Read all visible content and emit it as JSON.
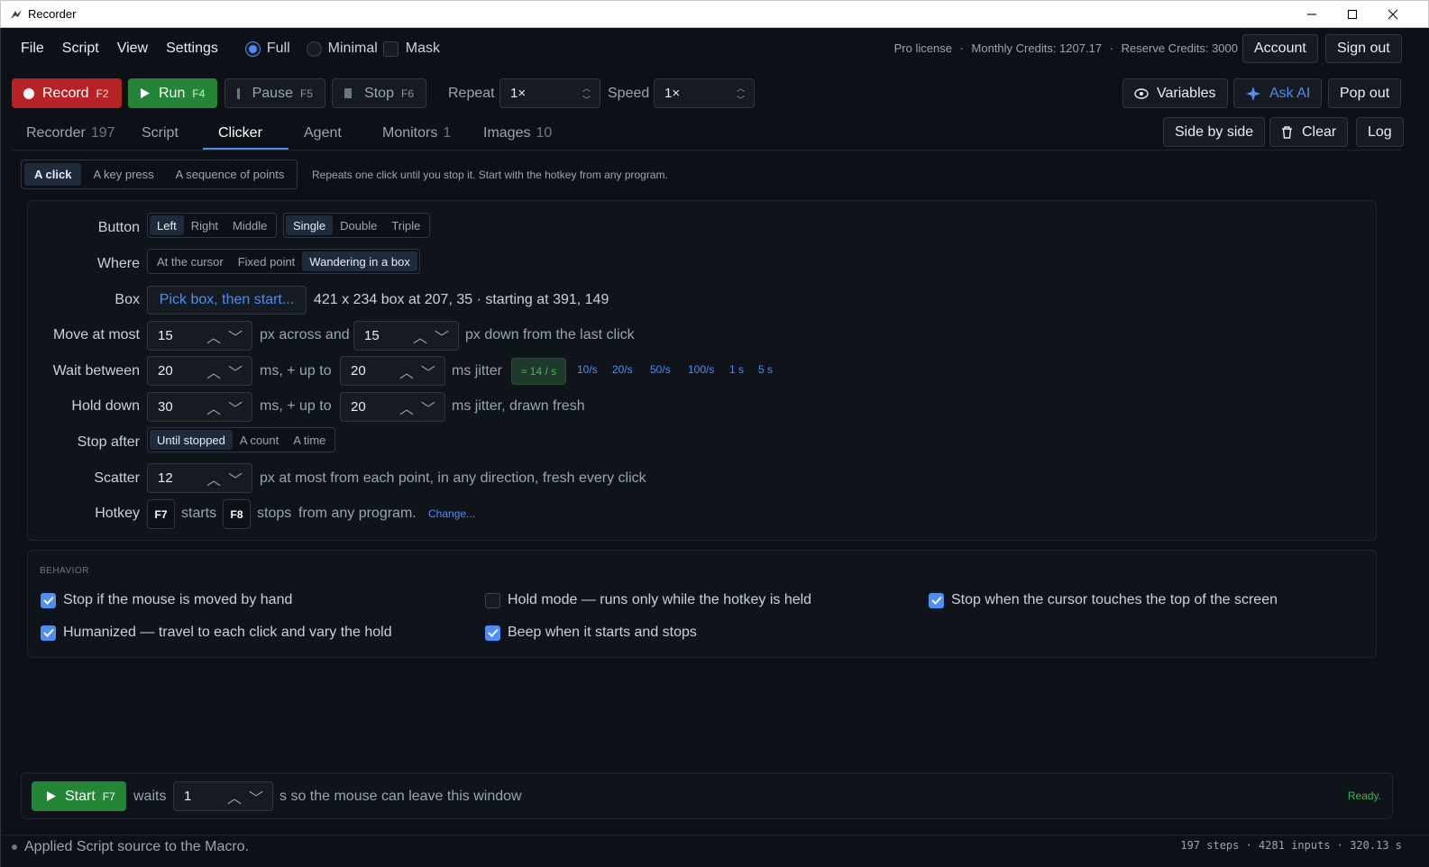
{
  "window": {
    "title": "Recorder"
  },
  "menu": {
    "items": [
      "File",
      "Script",
      "View",
      "Settings"
    ]
  },
  "view_mode": {
    "options": [
      "Full",
      "Minimal"
    ],
    "selected": "Full",
    "mask_label": "Mask",
    "mask_checked": false
  },
  "account": {
    "license": "Pro license",
    "monthly_credits": "Monthly Credits: 1207.17",
    "reserve_credits": "Reserve Credits: 3000",
    "account_label": "Account",
    "signout_label": "Sign out"
  },
  "toolbar": {
    "record": {
      "label": "Record",
      "key": "F2"
    },
    "run": {
      "label": "Run",
      "key": "F4"
    },
    "pause": {
      "label": "Pause",
      "key": "F5"
    },
    "stop": {
      "label": "Stop",
      "key": "F6"
    },
    "repeat_label": "Repeat",
    "repeat_value": "1×",
    "speed_label": "Speed",
    "speed_value": "1×",
    "variables_label": "Variables",
    "ask_ai_label": "Ask AI",
    "popout_label": "Pop out"
  },
  "tabs": [
    {
      "label": "Recorder",
      "count": "197"
    },
    {
      "label": "Script",
      "count": ""
    },
    {
      "label": "Clicker",
      "count": "",
      "active": true
    },
    {
      "label": "Agent",
      "count": ""
    },
    {
      "label": "Monitors",
      "count": "1"
    },
    {
      "label": "Images",
      "count": "10"
    }
  ],
  "tab_actions": {
    "side_by_side": "Side by side",
    "clear": "Clear",
    "log": "Log"
  },
  "clicker": {
    "mode": {
      "options": [
        "A click",
        "A key press",
        "A sequence of points"
      ],
      "selected": "A click"
    },
    "mode_help": "Repeats one click until you stop it. Start with the hotkey from any program.",
    "button": {
      "label": "Button",
      "which": [
        "Left",
        "Right",
        "Middle"
      ],
      "which_selected": "Left",
      "count": [
        "Single",
        "Double",
        "Triple"
      ],
      "count_selected": "Single"
    },
    "where": {
      "label": "Where",
      "options": [
        "At the cursor",
        "Fixed point",
        "Wandering in a box"
      ],
      "selected": "Wandering in a box"
    },
    "box": {
      "label": "Box",
      "pick_label": "Pick box, then start...",
      "info": "421 x 234 box at 207, 35 · starting at 391, 149"
    },
    "move": {
      "label": "Move at most",
      "across": "15",
      "across_unit": "px across and",
      "down": "15",
      "down_unit": "px down from the last click"
    },
    "wait": {
      "label": "Wait between",
      "base": "20",
      "base_unit": "ms, + up to",
      "jitter": "20",
      "jitter_unit": "ms jitter",
      "rate_badge": "≈ 14 / s",
      "presets": [
        "10/s",
        "20/s",
        "50/s",
        "100/s",
        "1 s",
        "5 s"
      ]
    },
    "hold": {
      "label": "Hold down",
      "base": "30",
      "base_unit": "ms, + up to",
      "jitter": "20",
      "jitter_unit": "ms jitter, drawn fresh"
    },
    "stop_after": {
      "label": "Stop after",
      "options": [
        "Until stopped",
        "A count",
        "A time"
      ],
      "selected": "Until stopped"
    },
    "scatter": {
      "label": "Scatter",
      "value": "12",
      "unit": "px at most from each point, in any direction, fresh every click"
    },
    "hotkey": {
      "label": "Hotkey",
      "start_key": "F7",
      "starts": "starts",
      "stop_key": "F8",
      "stops": "stops",
      "suffix": "from any program.",
      "change": "Change..."
    }
  },
  "behavior": {
    "header": "BEHAVIOR",
    "options": [
      {
        "label": "Stop if the mouse is moved by hand",
        "checked": true
      },
      {
        "label": "Hold mode — runs only while the hotkey is held",
        "checked": false
      },
      {
        "label": "Stop when the cursor touches the top of the screen",
        "checked": true
      },
      {
        "label": "Humanized — travel to each click and vary the hold",
        "checked": true
      },
      {
        "label": "Beep when it starts and stops",
        "checked": true
      }
    ]
  },
  "start_bar": {
    "label": "Start",
    "key": "F7",
    "waits": "waits",
    "delay": "1",
    "suffix": "s so the mouse can leave this window",
    "status": "Ready."
  },
  "statusbar": {
    "message": "Applied Script source to the Macro.",
    "stats": "197 steps  ·  4281 inputs  ·  320.13 s"
  }
}
